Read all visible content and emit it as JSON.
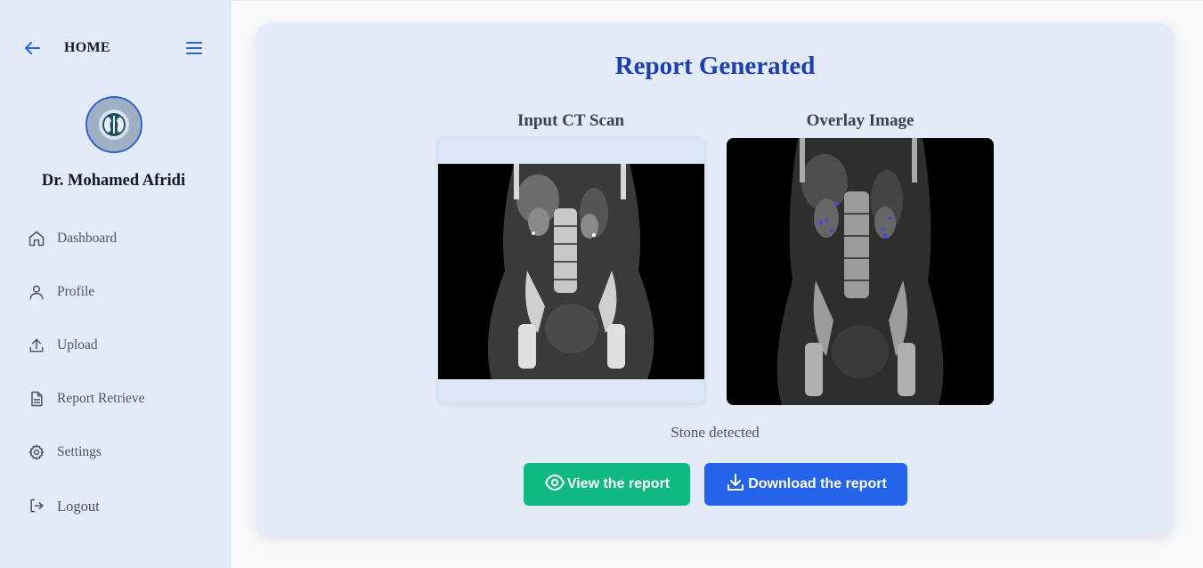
{
  "sidebar": {
    "home_label": "HOME",
    "doctor_name": "Dr. Mohamed Afridi",
    "items": [
      {
        "label": "Dashboard",
        "icon": "home-icon"
      },
      {
        "label": "Profile",
        "icon": "user-icon"
      },
      {
        "label": "Upload",
        "icon": "upload-icon"
      },
      {
        "label": "Report Retrieve",
        "icon": "document-icon"
      },
      {
        "label": "Settings",
        "icon": "gear-icon"
      },
      {
        "label": "Logout",
        "icon": "logout-icon"
      }
    ]
  },
  "report": {
    "title": "Report Generated",
    "input_label": "Input CT Scan",
    "overlay_label": "Overlay Image",
    "status": "Stone detected",
    "view_button": "View the report",
    "download_button": "Download the report"
  },
  "colors": {
    "sidebar_bg": "#e3ebf8",
    "title": "#1e40af",
    "view_button": "#10b981",
    "download_button": "#2563eb"
  }
}
